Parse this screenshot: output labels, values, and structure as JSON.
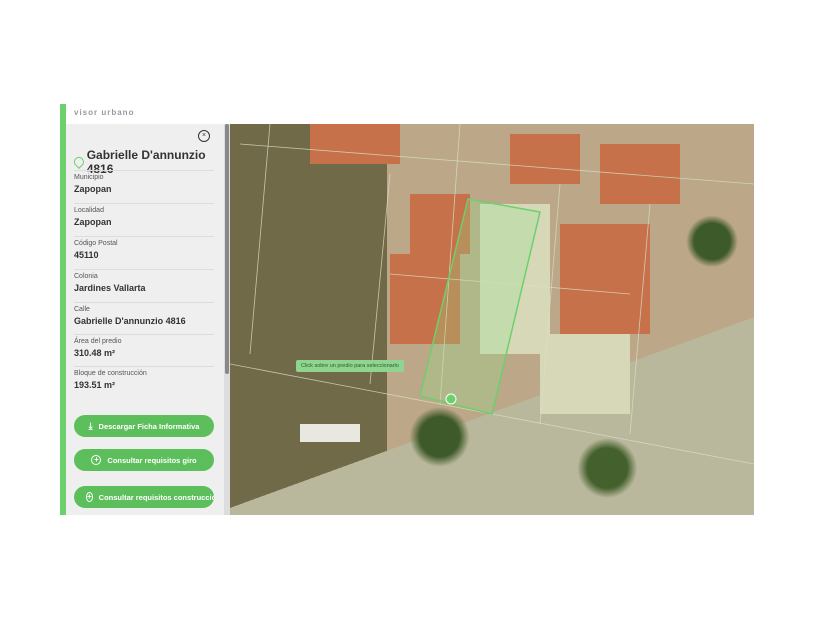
{
  "header": {
    "logo": "visor urbano"
  },
  "panel": {
    "close_icon": "close-circle-icon",
    "title": "Gabrielle D'annunzio 4816",
    "fields": [
      {
        "label": "Municipio",
        "value": "Zapopan"
      },
      {
        "label": "Localidad",
        "value": "Zapopan"
      },
      {
        "label": "Código Postal",
        "value": "45110"
      },
      {
        "label": "Colonia",
        "value": "Jardines Vallarta"
      },
      {
        "label": "Calle",
        "value": "Gabrielle D'annunzio 4816"
      },
      {
        "label": "Área del predio",
        "value": "310.48 m²"
      },
      {
        "label": "Bloque de construcción",
        "value": "193.51 m²"
      }
    ],
    "buttons": [
      {
        "label": "Descargar Ficha Informativa",
        "icon": "download-icon"
      },
      {
        "label": "Consultar requisitos giro",
        "icon": "plus-circle-icon"
      },
      {
        "label": "Consultar requisitos construcción",
        "icon": "plus-circle-icon"
      }
    ]
  },
  "map": {
    "tooltip": "Click sobre un predio para seleccionarlo",
    "accent": "#6cd06c"
  }
}
